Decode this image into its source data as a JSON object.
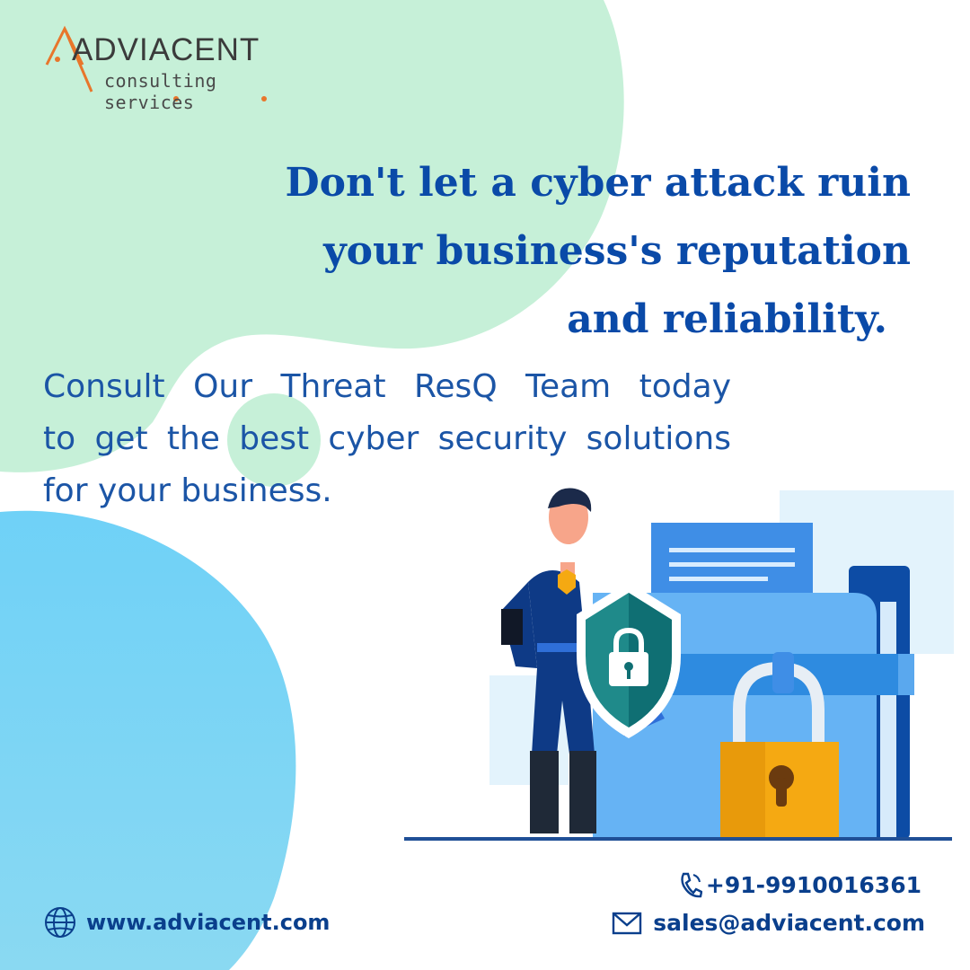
{
  "brand": {
    "logo_text": "ADVIACENT",
    "logo_tagline": "consulting services"
  },
  "headline": {
    "line1": "Don't let a cyber attack ruin",
    "line2": "your business's reputation",
    "line3": "and reliability."
  },
  "body": {
    "line1": "Consult Our Threat ResQ Team today",
    "line2": "to get the best cyber security solutions",
    "line3": "for your business."
  },
  "contact": {
    "website": "www.adviacent.com",
    "phone": "+91-9910016361",
    "email": "sales@adviacent.com"
  },
  "illustration": {
    "icons": [
      "superhero-figure",
      "shield-lock-icon",
      "folder-icon",
      "padlock-icon"
    ]
  },
  "colors": {
    "headline": "#0a4aa8",
    "body": "#1b55a6",
    "footer": "#0a3f8c",
    "green_blob": "#c6f0d8",
    "blue_blob": "#7fd3f5",
    "logo_orange": "#e8762b"
  }
}
